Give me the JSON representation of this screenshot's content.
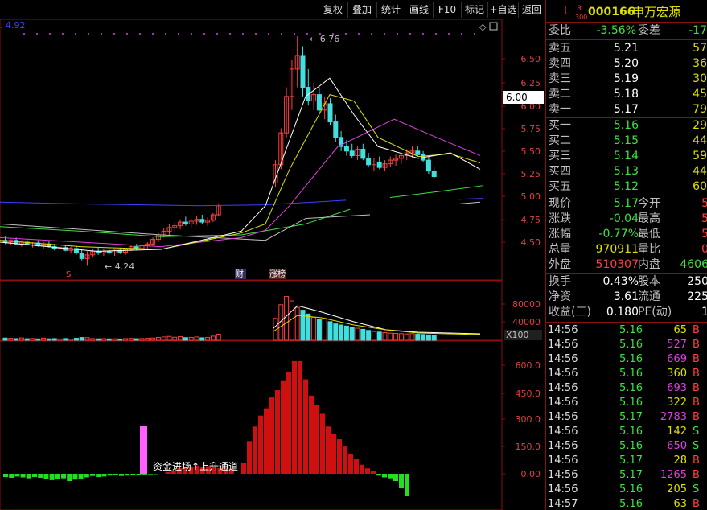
{
  "toolbar": {
    "buttons": [
      "复权",
      "叠加",
      "统计",
      "画线",
      "F10",
      "标记",
      "+自选",
      "返回"
    ]
  },
  "main_chart": {
    "ma_label": "4.92",
    "price_ticks": [
      "6.50",
      "6.25",
      "6.00",
      "5.75",
      "5.50",
      "5.25",
      "5.00",
      "4.75",
      "4.50"
    ],
    "current_price_box": "6.00",
    "high_marker": "6.76",
    "low_marker": "4.24",
    "event_labels": [
      "S",
      "财",
      "涨榜"
    ]
  },
  "volume_chart": {
    "ticks": [
      "80000",
      "40000"
    ],
    "unit": "X100"
  },
  "indicator_chart": {
    "ticks": [
      "600.0",
      "450.0",
      "300.0",
      "150.0",
      "0.00"
    ],
    "annotation": "资金进场↑上升通道"
  },
  "quote": {
    "market_flag": "L",
    "r_flag": "R",
    "r_sub": "300",
    "code": "000166",
    "name": "申万宏源",
    "weibi_label": "委比",
    "weibi_value": "-3.56%",
    "weicha_label": "委差",
    "weicha_value": "-17",
    "asks": [
      {
        "label": "卖五",
        "price": "5.21",
        "vol": "57"
      },
      {
        "label": "卖四",
        "price": "5.20",
        "vol": "36"
      },
      {
        "label": "卖三",
        "price": "5.19",
        "vol": "30"
      },
      {
        "label": "卖二",
        "price": "5.18",
        "vol": "45"
      },
      {
        "label": "卖一",
        "price": "5.17",
        "vol": "79"
      }
    ],
    "bids": [
      {
        "label": "买一",
        "price": "5.16",
        "vol": "29"
      },
      {
        "label": "买二",
        "price": "5.15",
        "vol": "44"
      },
      {
        "label": "买三",
        "price": "5.14",
        "vol": "59"
      },
      {
        "label": "买四",
        "price": "5.13",
        "vol": "44"
      },
      {
        "label": "买五",
        "price": "5.12",
        "vol": "60"
      }
    ],
    "stats": [
      {
        "l1": "现价",
        "v1": "5.17",
        "l2": "今开",
        "v2": "5"
      },
      {
        "l1": "涨跌",
        "v1": "-0.04",
        "l2": "最高",
        "v2": "5"
      },
      {
        "l1": "涨幅",
        "v1": "-0.77%",
        "l2": "最低",
        "v2": "5"
      },
      {
        "l1": "总量",
        "v1": "970911",
        "l2": "量比",
        "v2": "0"
      },
      {
        "l1": "外盘",
        "v1": "510307",
        "l2": "内盘",
        "v2": "4606"
      }
    ],
    "stats2": [
      {
        "l1": "换手",
        "v1": "0.43%",
        "l2": "股本",
        "v2": "250"
      },
      {
        "l1": "净资",
        "v1": "3.61",
        "l2": "流通",
        "v2": "225"
      },
      {
        "l1": "收益(三)",
        "v1": "0.180",
        "l2": "PE(动)",
        "v2": "1"
      }
    ],
    "ticks": [
      {
        "t": "14:56",
        "p": "5.16",
        "v": "65",
        "d": "B"
      },
      {
        "t": "14:56",
        "p": "5.16",
        "v": "527",
        "d": "B"
      },
      {
        "t": "14:56",
        "p": "5.16",
        "v": "669",
        "d": "B"
      },
      {
        "t": "14:56",
        "p": "5.16",
        "v": "360",
        "d": "B"
      },
      {
        "t": "14:56",
        "p": "5.16",
        "v": "693",
        "d": "B"
      },
      {
        "t": "14:56",
        "p": "5.16",
        "v": "322",
        "d": "B"
      },
      {
        "t": "14:56",
        "p": "5.17",
        "v": "2783",
        "d": "B"
      },
      {
        "t": "14:56",
        "p": "5.16",
        "v": "142",
        "d": "S"
      },
      {
        "t": "14:56",
        "p": "5.16",
        "v": "650",
        "d": "S"
      },
      {
        "t": "14:56",
        "p": "5.17",
        "v": "28",
        "d": "B"
      },
      {
        "t": "14:56",
        "p": "5.17",
        "v": "1265",
        "d": "B"
      },
      {
        "t": "14:56",
        "p": "5.16",
        "v": "205",
        "d": "S"
      },
      {
        "t": "14:57",
        "p": "5.16",
        "v": "63",
        "d": "B"
      }
    ]
  },
  "colors": {
    "up": "#ff4040",
    "down": "#40e0e0",
    "grid": "#8a1010",
    "ma5": "#ffffff",
    "ma10": "#e0e000",
    "ma20": "#e040e0",
    "ma60": "#40e040",
    "ma120": "#4040ff"
  }
}
